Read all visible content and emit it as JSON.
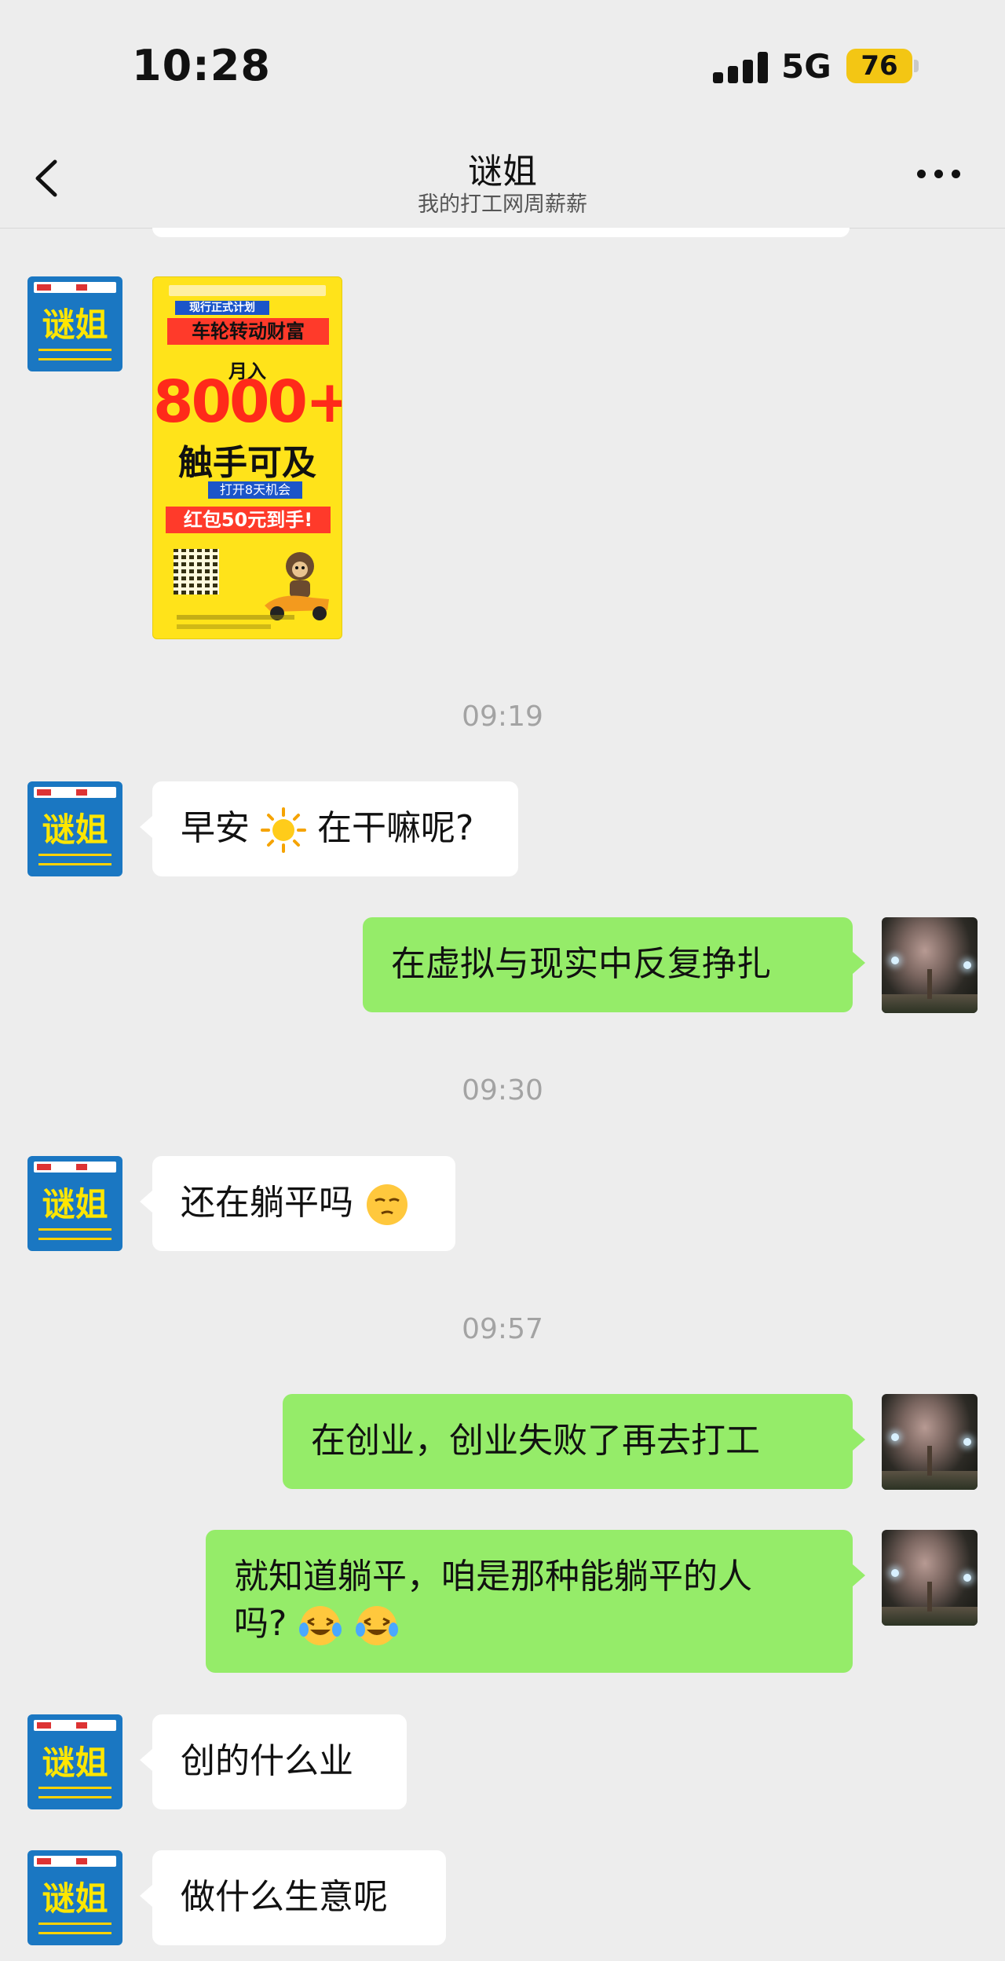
{
  "status_bar": {
    "time": "10:28",
    "network": "5G",
    "battery": "76"
  },
  "nav": {
    "title": "谜姐",
    "subtitle": "我的打工网周薪薪"
  },
  "avatars": {
    "contact_name_mark": "谜姐"
  },
  "poster": {
    "banner_small": "现行正式计划",
    "headline": "车轮转动财富",
    "income_label": "月入",
    "income_value": "8000+",
    "slogan": "触手可及",
    "tag": "打开8天机会",
    "bonus": "红包50元到手!"
  },
  "timestamps": [
    "09:19",
    "09:30",
    "09:57"
  ],
  "messages": [
    {
      "side": "left",
      "before": "早安",
      "emoji": "sun",
      "after": "在干嘛呢?"
    },
    {
      "side": "right",
      "text": "在虚拟与现实中反复挣扎"
    },
    {
      "side": "left",
      "text": "还在躺平吗",
      "emoji": "smirk-face"
    },
    {
      "side": "right",
      "text": "在创业，创业失败了再去打工"
    },
    {
      "side": "right",
      "line1": "就知道躺平，咱是那种能躺平的人",
      "line2": "吗?",
      "emoji": "crying-laughing-face"
    },
    {
      "side": "left",
      "text": "创的什么业"
    },
    {
      "side": "left",
      "text": "做什么生意呢"
    }
  ],
  "colors": {
    "background": "#ededed",
    "sent_bubble": "#95ec69",
    "received_bubble": "#ffffff",
    "avatar_blue": "#1a77c2",
    "avatar_yellow_text": "#ffe600",
    "battery": "#f3c614"
  }
}
